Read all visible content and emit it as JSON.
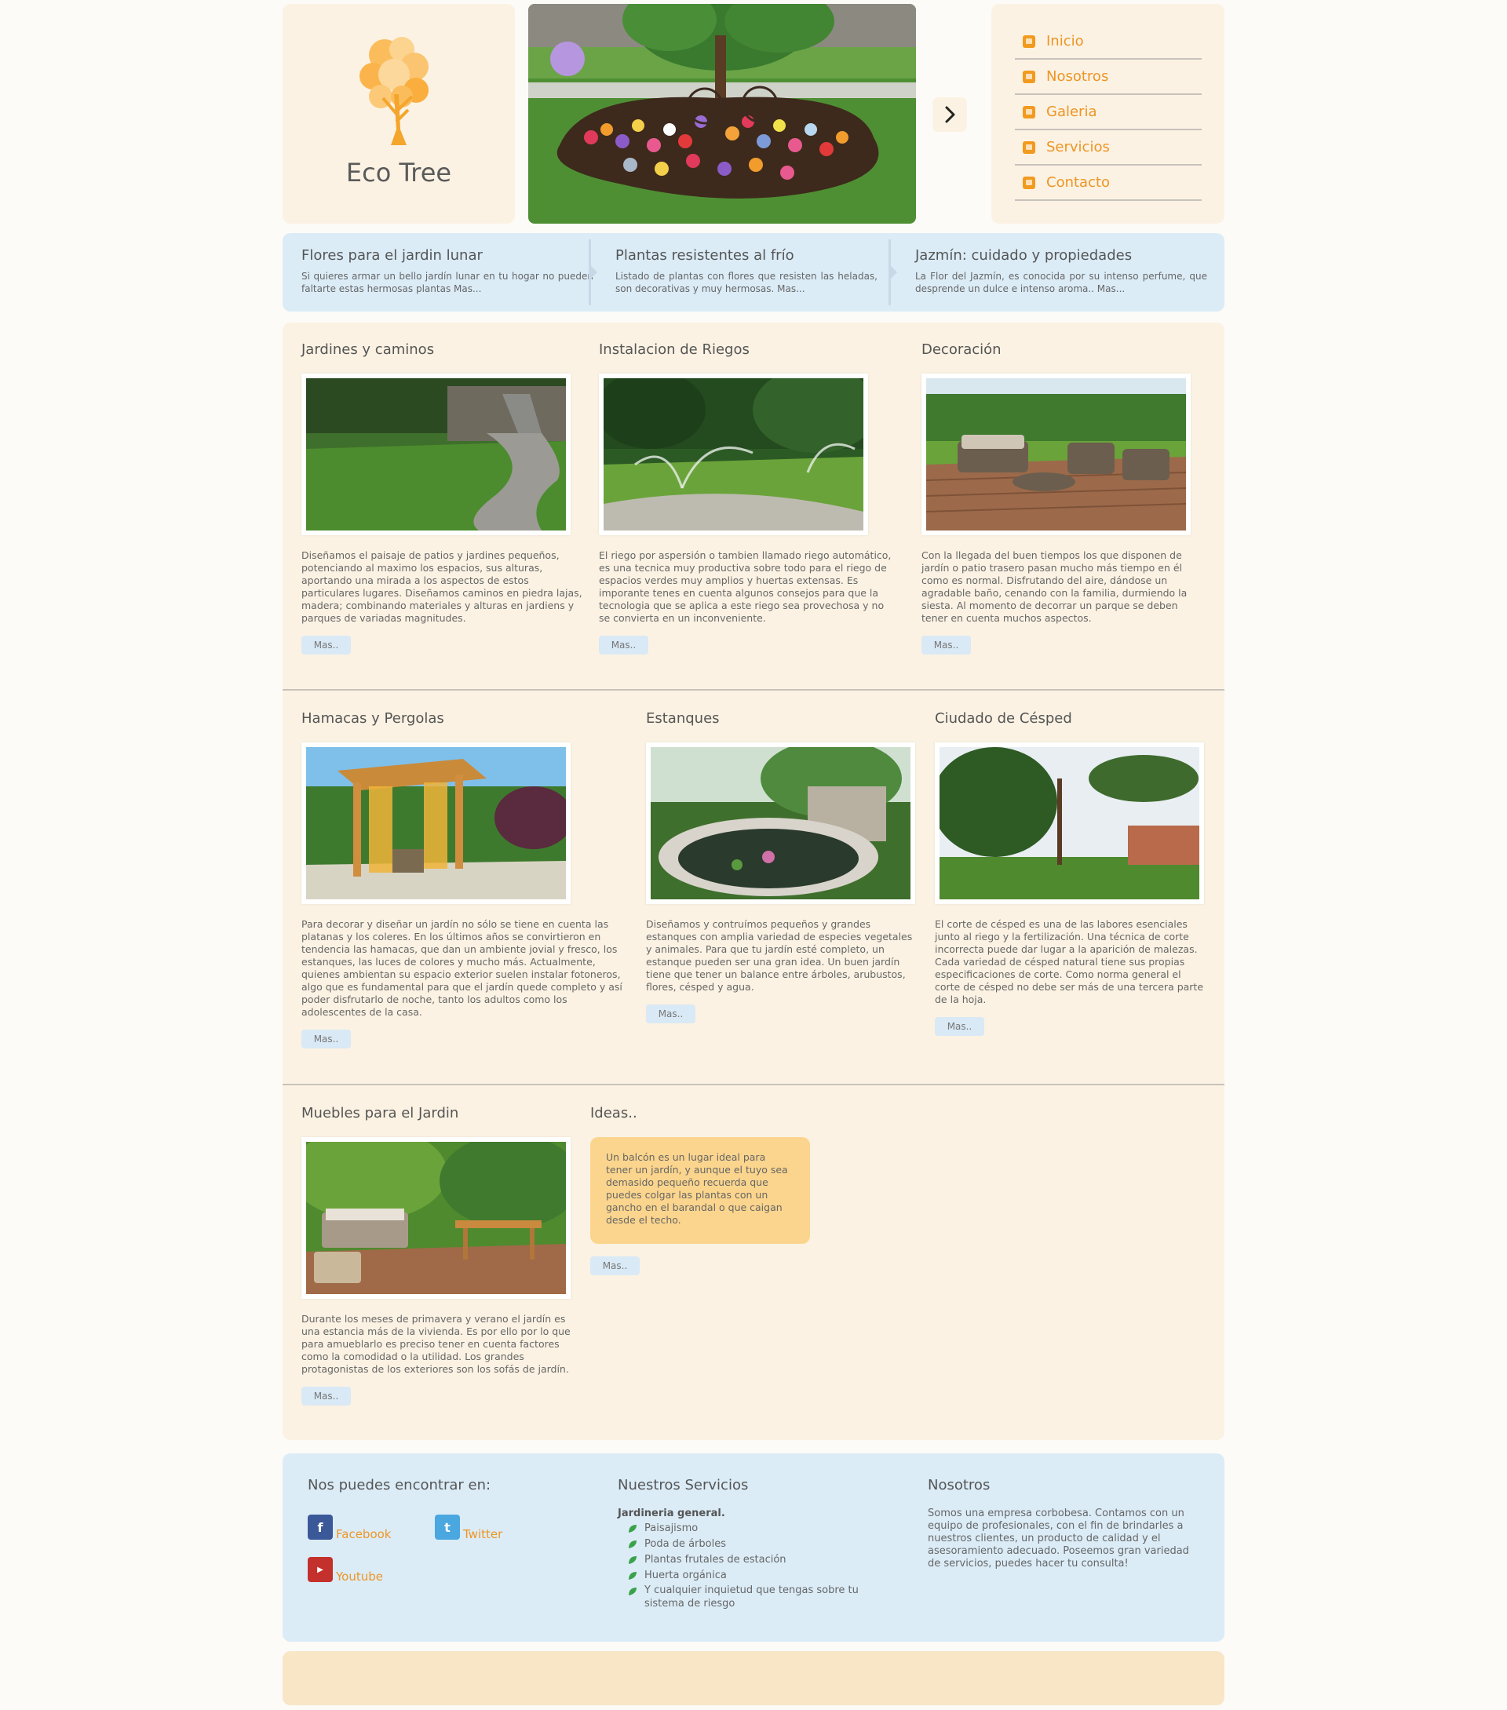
{
  "brand": {
    "name": "Eco Tree"
  },
  "nav": {
    "items": [
      {
        "label": "Inicio",
        "icon": "home-icon"
      },
      {
        "label": "Nosotros",
        "icon": "users-icon"
      },
      {
        "label": "Galeria",
        "icon": "gallery-icon"
      },
      {
        "label": "Servicios",
        "icon": "services-icon"
      },
      {
        "label": "Contacto",
        "icon": "mail-icon"
      }
    ],
    "accent": "#ee9524"
  },
  "news": [
    {
      "title": "Flores para el jardin lunar",
      "text": "Si quieres armar un bello jardín lunar en tu hogar no pueden faltarte estas hermosas plantas Mas..."
    },
    {
      "title": "Plantas resistentes al frío",
      "text": "Listado de plantas con flores que resisten las heladas, son decorativas y muy hermosas. Mas..."
    },
    {
      "title": "Jazmín: cuidado y propiedades",
      "text": "La Flor del Jazmín, es conocida por su intenso perfume, que desprende un dulce e intenso aroma.. Mas..."
    }
  ],
  "cards": [
    {
      "title": "Jardines y caminos",
      "text": "Diseñamos el paisaje de patios y jardines pequeños, potenciando al maximo los espacios, sus alturas, aportando una mirada a los aspectos de estos particulares lugares. Diseñamos caminos en piedra lajas, madera; combinando materiales y alturas en jardiens y parques de variadas magnitudes.",
      "button": "Mas.."
    },
    {
      "title": "Instalacion de Riegos",
      "text": "El riego por aspersión o tambien llamado riego automático, es una tecnica muy productiva sobre todo para el riego de espacios verdes muy amplios y huertas extensas. Es imporante tenes en cuenta algunos consejos para que la tecnologia que se aplica a este riego sea provechosa y no se convierta en un inconveniente.",
      "button": "Mas.."
    },
    {
      "title": "Decoración",
      "text": "Con la llegada del buen tiempos los que disponen de jardín o patio trasero pasan mucho más tiempo en él como es normal. Disfrutando del aire, dándose un agradable baño, cenando con la familia, durmiendo la siesta. Al momento de decorrar un parque se deben tener en cuenta muchos aspectos.",
      "button": "Mas.."
    },
    {
      "title": "Hamacas y Pergolas",
      "text": "Para decorar y diseñar un jardín no sólo se tiene en cuenta las platanas y los coleres. En los últimos años se convirtieron en tendencia las hamacas, que dan un ambiente jovial y fresco, los estanques, las luces de colores y mucho más. Actualmente, quienes ambientan su espacio exterior suelen instalar fotoneros, algo que es fundamental para que el jardín quede completo y así poder disfrutarlo de noche, tanto los adultos como los adolescentes de la casa.",
      "button": "Mas.."
    },
    {
      "title": "Estanques",
      "text": "Diseñamos y contruímos pequeños y grandes estanques con amplia variedad de especies vegetales y animales. Para que tu jardín esté completo, un estanque pueden ser una gran idea. Un buen jardín tiene que tener un balance entre árboles, arubustos, flores, césped y agua.",
      "button": "Mas.."
    },
    {
      "title": "Ciudado de Césped",
      "text": "El corte de césped es una de las labores esenciales junto al riego y la fertilización. Una técnica de corte incorrecta puede dar lugar a la aparición de malezas. Cada variedad de césped natural tiene sus propias especificaciones de corte. Como norma general el corte de césped no debe ser más de una tercera parte de la hoja.",
      "button": "Mas.."
    },
    {
      "title": "Muebles para el Jardin",
      "text": "Durante los meses de primavera y verano el jardín es una estancia más de la vivienda. Es por ello por lo que para amueblarlo es preciso tener en cuenta factores como la comodidad o la utilidad. Los grandes protagonistas de los exteriores son los sofás de jardín.",
      "button": "Mas.."
    }
  ],
  "ideas": {
    "title": "Ideas..",
    "text": "Un balcón es un lugar ideal para tener un jardín, y aunque el tuyo sea demasido pequeño recuerda que puedes colgar las plantas con un gancho en el barandal o que caigan desde el techo.",
    "button": "Mas.."
  },
  "footer": {
    "find_title": "Nos puedes encontrar en:",
    "social": [
      {
        "label": "Facebook",
        "icon": "facebook-icon",
        "color": "#3b5998"
      },
      {
        "label": "Twitter",
        "icon": "twitter-icon",
        "color": "#4aa7e0"
      },
      {
        "label": "Youtube",
        "icon": "youtube-icon",
        "color": "#c4302b"
      }
    ],
    "services_title": "Nuestros Servicios",
    "services_heading": "Jardineria general.",
    "services": [
      "Paisajismo",
      "Poda de árboles",
      "Plantas frutales de estación",
      "Huerta orgánica",
      "Y cualquier inquietud que tengas sobre tu sistema de riesgo"
    ],
    "about_title": "Nosotros",
    "about_text": "Somos una empresa corbobesa. Contamos con un equipo de profesionales, con el fin de brindarles a nuestros clientes, un producto de calidad y el asesoramiento adecuado. Poseemos gran variedad de servicios, puedes hacer tu consulta!"
  }
}
